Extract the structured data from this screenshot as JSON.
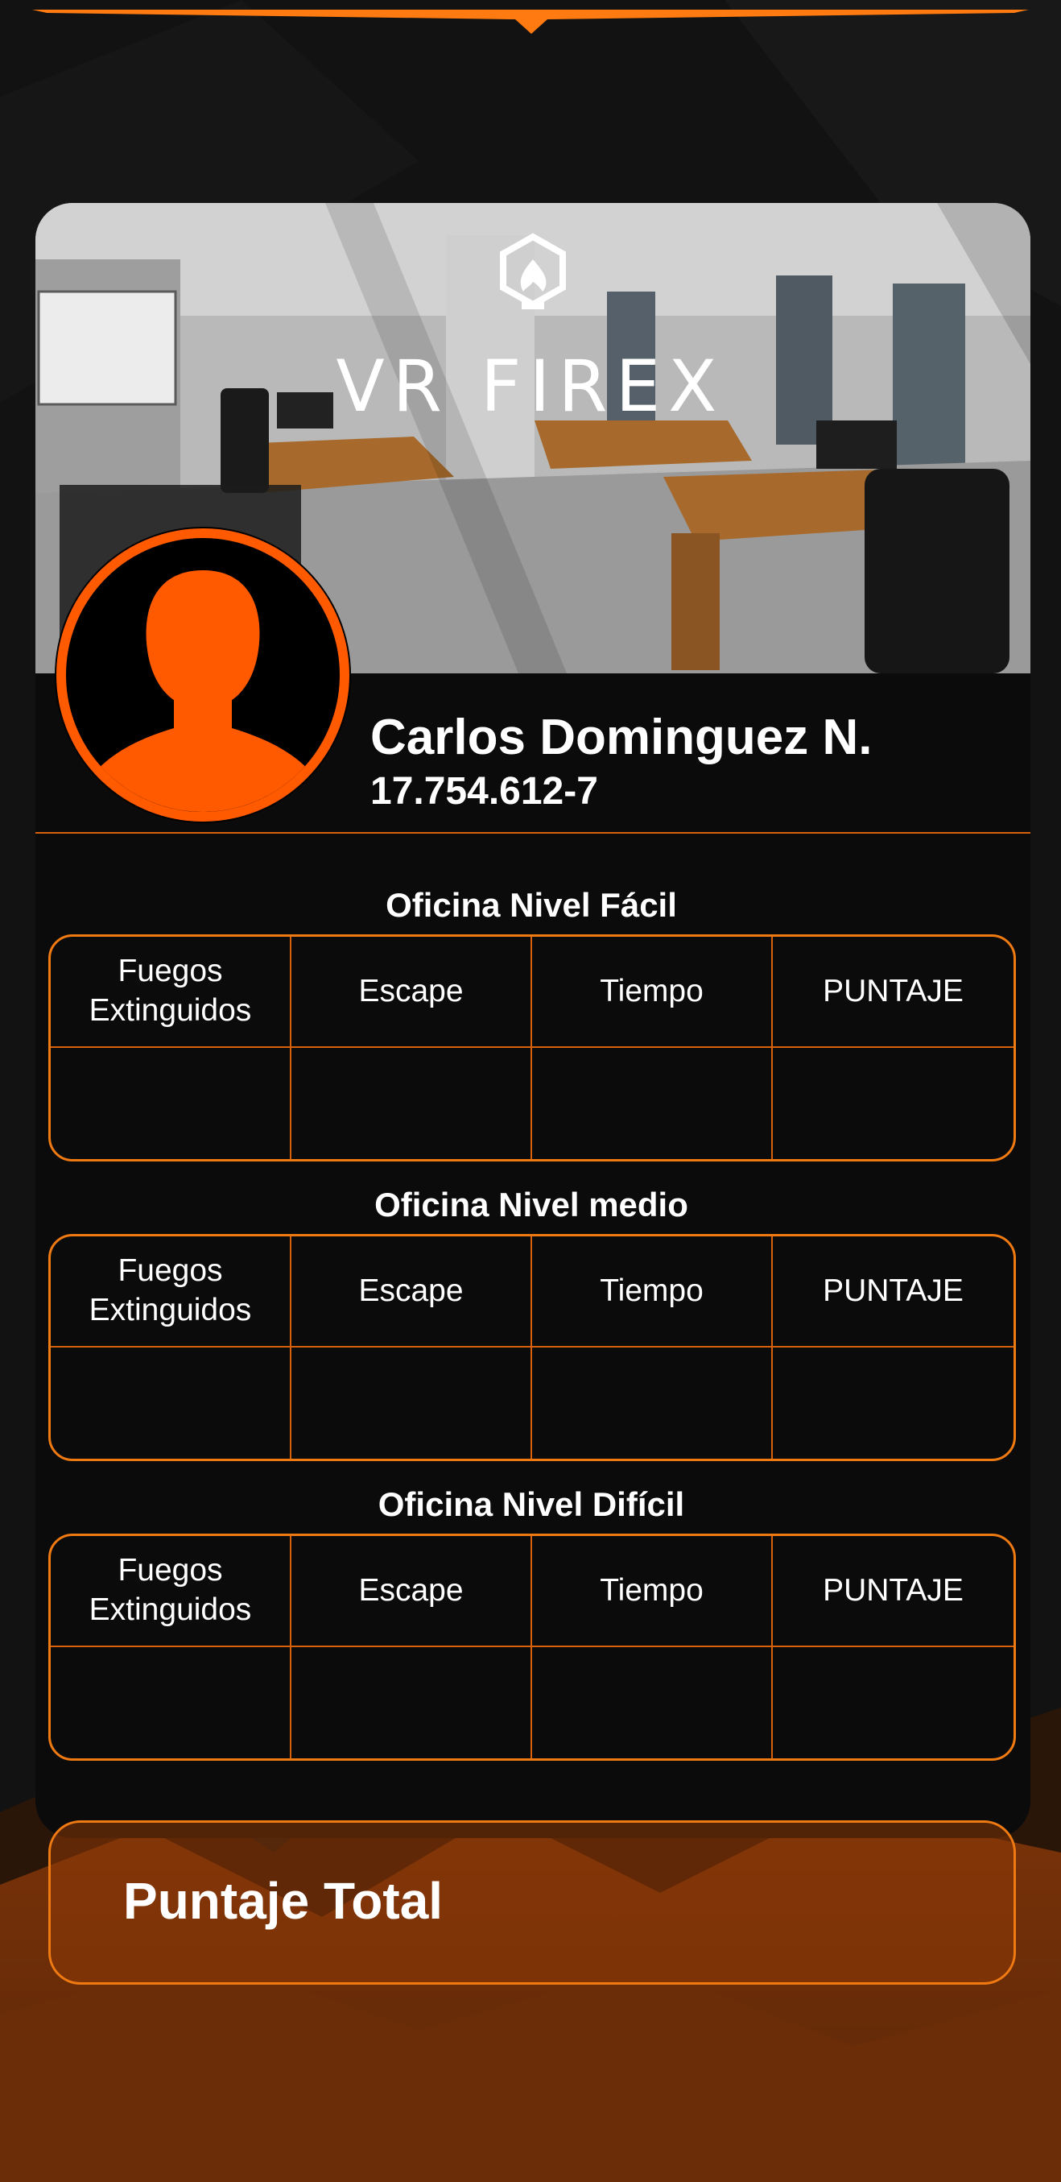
{
  "app": {
    "brand_name": "VR FIREX"
  },
  "profile": {
    "name": "Carlos Dominguez N.",
    "id_number": "17.754.612-7"
  },
  "levels": [
    {
      "title": "Oficina Nivel Fácil",
      "headers": [
        "Fuegos Extinguidos",
        "Escape",
        "Tiempo",
        "PUNTAJE"
      ],
      "values": [
        "",
        "",
        "",
        ""
      ]
    },
    {
      "title": "Oficina Nivel medio",
      "headers": [
        "Fuegos Extinguidos",
        "Escape",
        "Tiempo",
        "PUNTAJE"
      ],
      "values": [
        "",
        "",
        "",
        ""
      ]
    },
    {
      "title": "Oficina Nivel Difícil",
      "headers": [
        "Fuegos Extinguidos",
        "Escape",
        "Tiempo",
        "PUNTAJE"
      ],
      "values": [
        "",
        "",
        "",
        ""
      ]
    }
  ],
  "total": {
    "label": "Puntaje Total",
    "value": ""
  },
  "colors": {
    "accent": "#f07a12",
    "accent_dark": "#d8620c",
    "avatar_orange": "#ff5a00",
    "background": "#121212",
    "card": "#0b0b0b"
  },
  "icons": {
    "logo": "flame-shield-icon",
    "avatar": "user-silhouette-icon"
  }
}
